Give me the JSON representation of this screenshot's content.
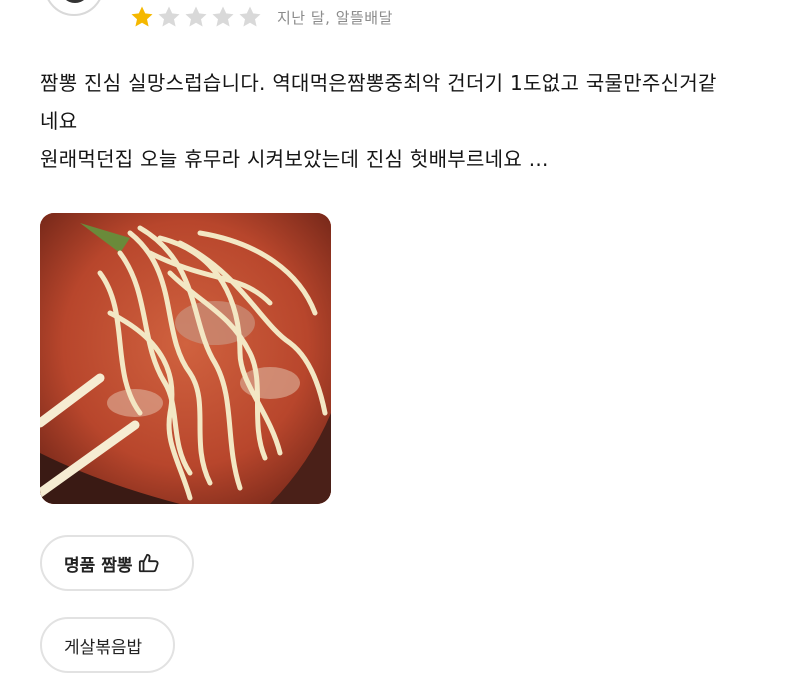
{
  "review": {
    "rating": 1,
    "max_rating": 5,
    "star_colors": {
      "filled": "#f5b800",
      "empty": "#d9d9d9"
    },
    "meta": "지난 달, 알뜰배달",
    "text_lines": [
      "짬뽕 진심 실망스럽습니다. 역대먹은짬뽕중최악 건더기 1도없고 국물만주신거같",
      "네요",
      "원래먹던집 오늘 휴무라 시켜보았는데 진심 헛배부르네요 ..."
    ]
  },
  "menu_chips": [
    {
      "label": "명품 짬뽕",
      "icon": "thumbs-up-icon",
      "liked": true
    },
    {
      "label": "게살볶음밥",
      "liked": false
    }
  ]
}
